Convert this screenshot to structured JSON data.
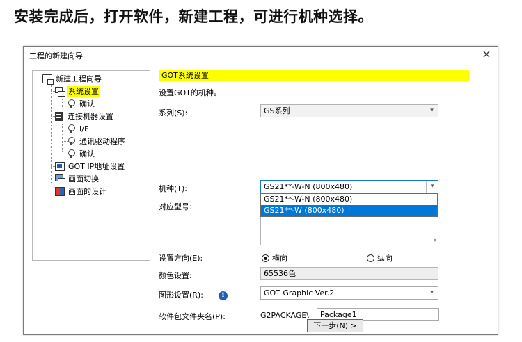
{
  "caption": "安装完成后，打开软件，新建工程，可进行机种选择。",
  "dialog": {
    "title": "工程的新建向导",
    "close_glyph": "×"
  },
  "tree": {
    "root": "新建工程向导",
    "system": "系统设置",
    "system_confirm": "确认",
    "connection": "连接机器设置",
    "if": "I/F",
    "driver": "通讯驱动程序",
    "conn_confirm": "确认",
    "ip": "GOT IP地址设置",
    "screen_switch": "画面切换",
    "screen_design": "画面的设计"
  },
  "content": {
    "banner": "GOT系统设置",
    "description": "设置GOT的机种。",
    "series_label": "系列(S):",
    "series_value": "GS系列",
    "model_label": "机种(T):",
    "model_value": "GS21**-W-N (800x480)",
    "model_options": [
      "GS21**-W-N (800x480)",
      "GS21**-W (800x480)"
    ],
    "model_selected_index": 1,
    "type_label": "对应型号:",
    "orientation_label": "设置方向(E):",
    "orientation_horizontal": "横向",
    "orientation_vertical": "纵向",
    "orientation_selected": "横向",
    "color_label": "颜色设置:",
    "color_value": "65536色",
    "graphic_label": "图形设置(R):",
    "graphic_value": "GOT Graphic Ver.2",
    "package_label": "软件包文件夹名(P):",
    "package_prefix": "G2PACKAGE\\",
    "package_value": "Package1",
    "next_button": "下一步(N) >"
  },
  "icons": {
    "combo_arrow": "▾",
    "scroll_arrow": "▾",
    "info": "i"
  },
  "colors": {
    "highlight": "#ffff00",
    "selection": "#0078d7",
    "focus_border": "#1976d2",
    "info_icon": "#1f5fb4"
  }
}
